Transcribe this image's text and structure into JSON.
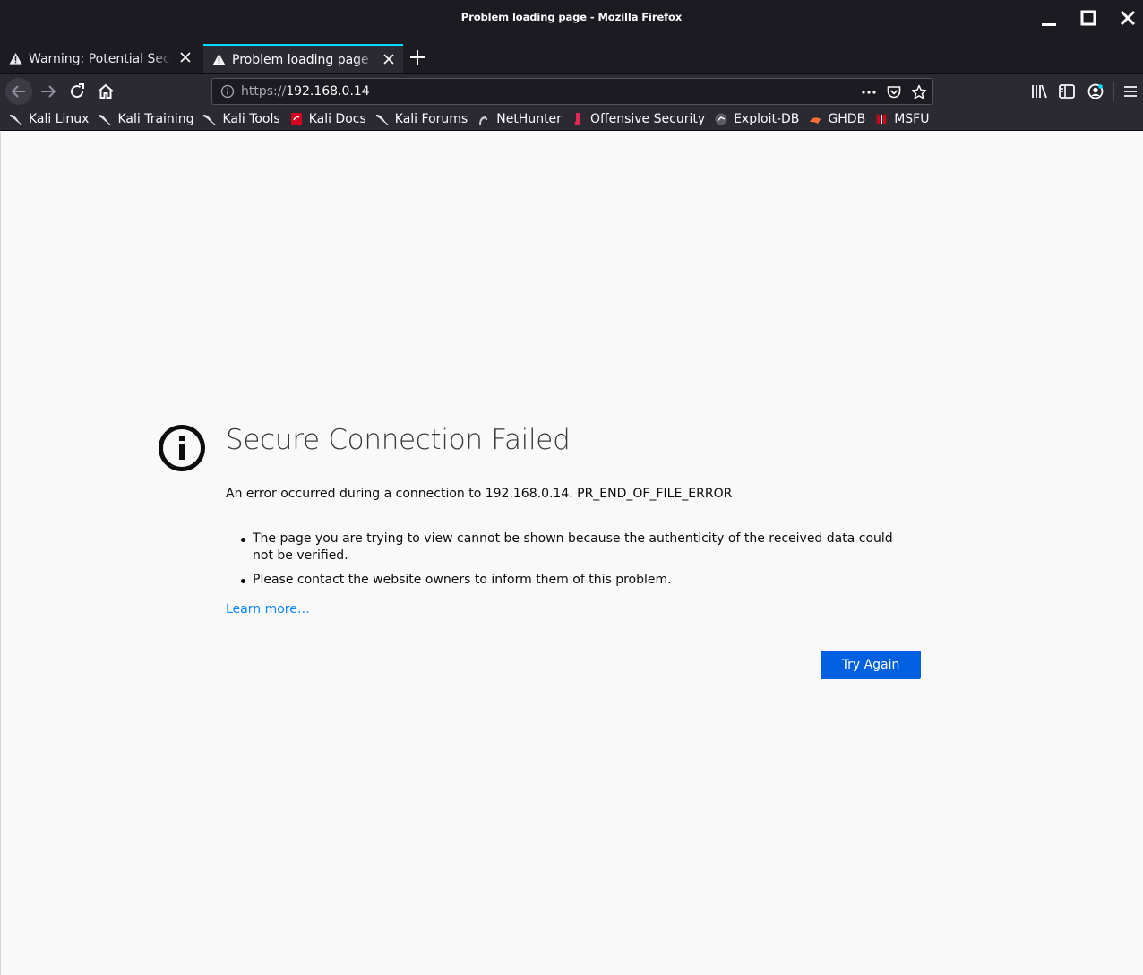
{
  "window": {
    "title": "Problem loading page - Mozilla Firefox"
  },
  "tabs": [
    {
      "label": "Warning: Potential Security Risk Ahead",
      "active": false,
      "icon": "warning-icon"
    },
    {
      "label": "Problem loading page",
      "active": true,
      "icon": "warning-icon"
    }
  ],
  "urlbar": {
    "scheme": "https://",
    "host": "192.168.0.14"
  },
  "bookmarks": [
    {
      "label": "Kali Linux",
      "icon": "kali-dragon-icon"
    },
    {
      "label": "Kali Training",
      "icon": "kali-dragon-icon"
    },
    {
      "label": "Kali Tools",
      "icon": "kali-dragon-icon"
    },
    {
      "label": "Kali Docs",
      "icon": "kali-docs-icon"
    },
    {
      "label": "Kali Forums",
      "icon": "kali-dragon-icon"
    },
    {
      "label": "NetHunter",
      "icon": "nethunter-icon"
    },
    {
      "label": "Offensive Security",
      "icon": "offensive-security-icon"
    },
    {
      "label": "Exploit-DB",
      "icon": "exploit-db-icon"
    },
    {
      "label": "GHDB",
      "icon": "ghdb-icon"
    },
    {
      "label": "MSFU",
      "icon": "msfu-icon"
    }
  ],
  "error": {
    "title": "Secure Connection Failed",
    "description": "An error occurred during a connection to 192.168.0.14. PR_END_OF_FILE_ERROR",
    "items": [
      "The page you are trying to view cannot be shown because the authenticity of the received data could not be verified.",
      "Please contact the website owners to inform them of this problem."
    ],
    "learn_more": "Learn more…",
    "try_again": "Try Again"
  },
  "colors": {
    "chrome_dark": "#1c1b22",
    "toolbar": "#2b2a33",
    "accent": "#0060df",
    "link": "#0a84ff"
  }
}
